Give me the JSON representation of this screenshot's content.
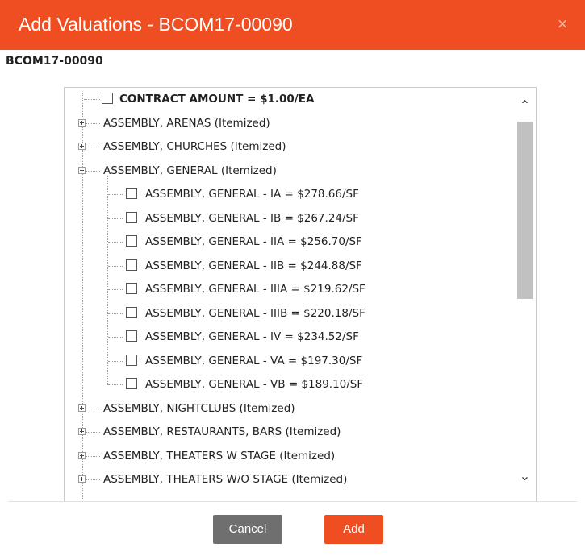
{
  "dialog": {
    "title": "Add Valuations - BCOM17-00090",
    "close_label": "×",
    "record_id": "BCOM17-00090"
  },
  "tree": {
    "root": {
      "label": "CONTRACT AMOUNT = $1.00/EA",
      "checked": false
    },
    "groups": [
      {
        "label": "ASSEMBLY, ARENAS (Itemized)",
        "expanded": false
      },
      {
        "label": "ASSEMBLY, CHURCHES (Itemized)",
        "expanded": false
      },
      {
        "label": "ASSEMBLY, GENERAL (Itemized)",
        "expanded": true,
        "children": [
          "ASSEMBLY, GENERAL - IA = $278.66/SF",
          "ASSEMBLY, GENERAL - IB = $267.24/SF",
          "ASSEMBLY, GENERAL - IIA = $256.70/SF",
          "ASSEMBLY, GENERAL - IIB = $244.88/SF",
          "ASSEMBLY, GENERAL - IIIA = $219.62/SF",
          "ASSEMBLY, GENERAL - IIIB = $220.18/SF",
          "ASSEMBLY, GENERAL - IV = $234.52/SF",
          "ASSEMBLY, GENERAL - VA = $197.30/SF",
          "ASSEMBLY, GENERAL - VB = $189.10/SF"
        ]
      },
      {
        "label": "ASSEMBLY, NIGHTCLUBS (Itemized)",
        "expanded": false
      },
      {
        "label": "ASSEMBLY, RESTAURANTS, BARS (Itemized)",
        "expanded": false
      },
      {
        "label": "ASSEMBLY, THEATERS W STAGE (Itemized)",
        "expanded": false
      },
      {
        "label": "ASSEMBLY, THEATERS W/O STAGE (Itemized)",
        "expanded": false
      }
    ]
  },
  "scrollbar": {
    "up_icon": "chevron-up-icon",
    "down_icon": "chevron-down-icon"
  },
  "buttons": {
    "cancel": "Cancel",
    "add": "Add"
  },
  "colors": {
    "accent": "#ee4e22",
    "cancel": "#6f6f6f"
  }
}
